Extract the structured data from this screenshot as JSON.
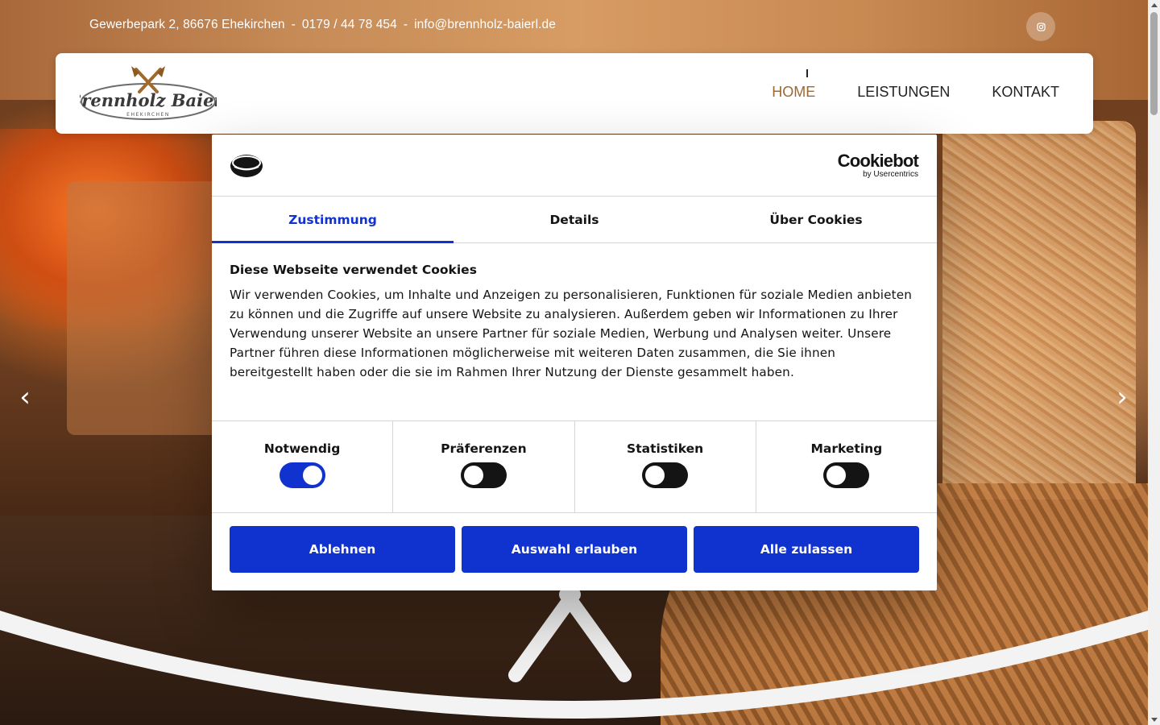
{
  "topbar": {
    "address": "Gewerbepark 2, 86676 Ehekirchen",
    "separator": "-",
    "phone": "0179 / 44 78 454",
    "email": "info@brennholz-baierl.de",
    "social_icon": "instagram-icon"
  },
  "header": {
    "logo_text": "Brennholz Baierl",
    "logo_subtext": "EHEKIRCHEN",
    "nav": [
      {
        "label": "HOME",
        "active": true
      },
      {
        "label": "LEISTUNGEN",
        "active": false
      },
      {
        "label": "KONTAKT",
        "active": false
      }
    ],
    "accent_color": "#a0682e"
  },
  "slider": {
    "prev_icon": "chevron-left-icon",
    "next_icon": "chevron-right-icon",
    "prev_glyph": "‹",
    "next_glyph": "›"
  },
  "cookie_dialog": {
    "brand": "Cookiebot",
    "brand_sub": "by Usercentrics",
    "tabs": [
      {
        "label": "Zustimmung",
        "active": true
      },
      {
        "label": "Details",
        "active": false
      },
      {
        "label": "Über Cookies",
        "active": false
      }
    ],
    "title": "Diese Webseite verwendet Cookies",
    "text": "Wir verwenden Cookies, um Inhalte und Anzeigen zu personalisieren, Funktionen für soziale Medien anbieten zu können und die Zugriffe auf unsere Website zu analysieren. Außerdem geben wir Informationen zu Ihrer Verwendung unserer Website an unsere Partner für soziale Medien, Werbung und Analysen weiter. Unsere Partner führen diese Informationen möglicherweise mit weiteren Daten zusammen, die Sie ihnen bereitgestellt haben oder die sie im Rahmen Ihrer Nutzung der Dienste gesammelt haben.",
    "toggles": [
      {
        "label": "Notwendig",
        "on": true
      },
      {
        "label": "Präferenzen",
        "on": false
      },
      {
        "label": "Statistiken",
        "on": false
      },
      {
        "label": "Marketing",
        "on": false
      }
    ],
    "buttons": {
      "decline": "Ablehnen",
      "allow_selection": "Auswahl erlauben",
      "allow_all": "Alle zulassen"
    },
    "accent_color": "#1032cf"
  }
}
